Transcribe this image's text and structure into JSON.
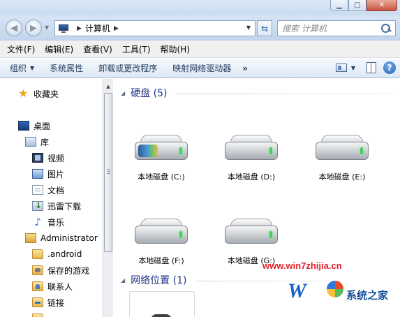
{
  "address": {
    "crumbs": [
      "计算机"
    ],
    "search_placeholder": "搜索 计算机"
  },
  "menu": [
    "文件(F)",
    "编辑(E)",
    "查看(V)",
    "工具(T)",
    "帮助(H)"
  ],
  "toolbar": {
    "organize": "组织",
    "system_properties": "系统属性",
    "uninstall": "卸载或更改程序",
    "map_drive": "映射网络驱动器",
    "more": "»"
  },
  "sidebar": {
    "favorites": "收藏夹",
    "desktop": "桌面",
    "libraries": "库",
    "videos": "视频",
    "pictures": "图片",
    "documents": "文档",
    "thunder": "迅雷下载",
    "music": "音乐",
    "user": "Administrator",
    "android": ".android",
    "saved_games": "保存的游戏",
    "contacts": "联系人",
    "links": "链接"
  },
  "groups": {
    "hard_disks": "硬盘 (5)",
    "network": "网络位置 (1)"
  },
  "drives": [
    {
      "label": "本地磁盘 (C:)"
    },
    {
      "label": "本地磁盘 (D:)"
    },
    {
      "label": "本地磁盘 (E:)"
    },
    {
      "label": "本地磁盘 (F:)"
    },
    {
      "label": "本地磁盘 (G:)"
    }
  ],
  "watermark": {
    "url": "www.win7zhijia.cn",
    "brand": "系统之家"
  }
}
